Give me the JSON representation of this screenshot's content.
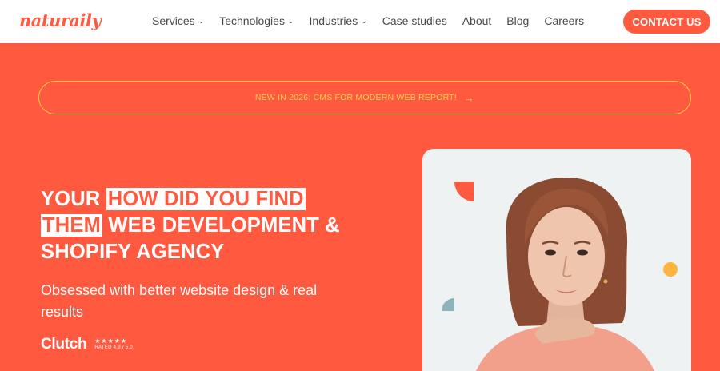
{
  "header": {
    "logo": "naturaily",
    "nav": [
      {
        "label": "Services",
        "dropdown": true
      },
      {
        "label": "Technologies",
        "dropdown": true
      },
      {
        "label": "Industries",
        "dropdown": true
      },
      {
        "label": "Case studies",
        "dropdown": false
      },
      {
        "label": "About",
        "dropdown": false
      },
      {
        "label": "Blog",
        "dropdown": false
      },
      {
        "label": "Careers",
        "dropdown": false
      }
    ],
    "contact_label": "CONTACT US"
  },
  "announcement": {
    "text": "NEW IN 2026: CMS FOR MODERN WEB REPORT!",
    "arrow": "→"
  },
  "hero": {
    "headline_prefix": "YOUR",
    "headline_highlight_1": "HOW DID YOU FIND",
    "headline_highlight_2": "THEM",
    "headline_rest_1": "WEB DEVELOPMENT &",
    "headline_rest_2": "SHOPIFY AGENCY",
    "subheadline": "Obsessed with better website design & real results",
    "clutch": {
      "logo": "Clutch",
      "stars": "★★★★★",
      "rating_text": "RATED 4.9 / 5.0"
    }
  },
  "colors": {
    "brand": "#ff5a40",
    "accent_yellow": "#ffcf4a",
    "card_bg": "#eef2f3"
  },
  "icons": {
    "dropdown": "chevron-down-icon",
    "announce_arrow": "arrow-right-icon"
  }
}
